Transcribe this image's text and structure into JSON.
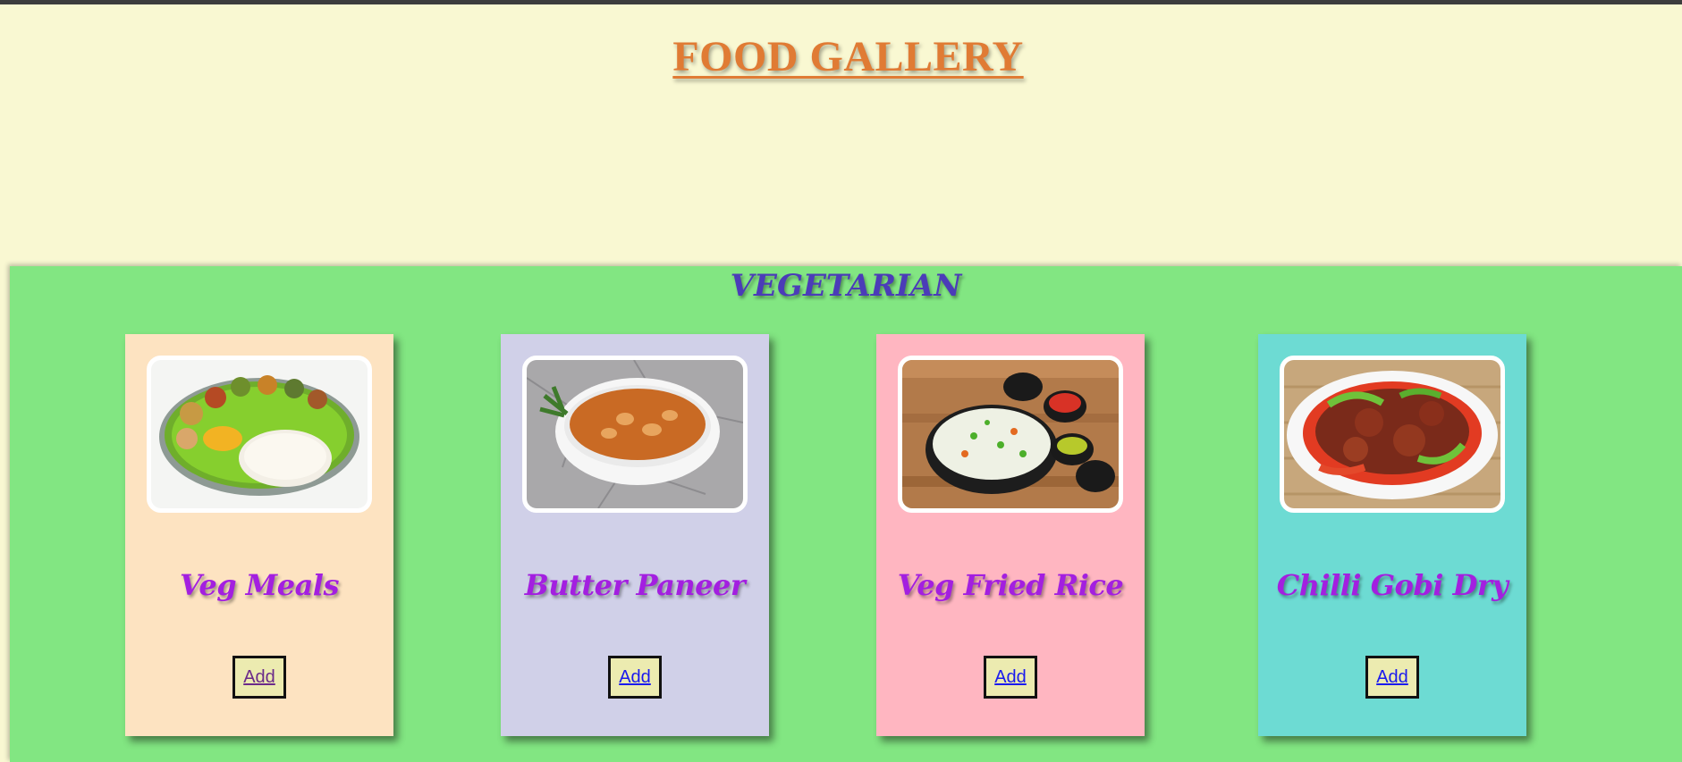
{
  "header": {
    "title": "FOOD GALLERY"
  },
  "section": {
    "title": "VEGETARIAN"
  },
  "cards": [
    {
      "name": "Veg Meals",
      "button_label": "Add",
      "bg_color": "#fde3c1",
      "image": "veg-meals-thali"
    },
    {
      "name": "Butter Paneer",
      "button_label": "Add",
      "bg_color": "#d0d0e8",
      "image": "butter-paneer-bowl"
    },
    {
      "name": "Veg Fried Rice",
      "button_label": "Add",
      "bg_color": "#ffb6c1",
      "image": "veg-fried-rice-bowl"
    },
    {
      "name": "Chilli Gobi Dry",
      "button_label": "Add",
      "bg_color": "#6ddbd3",
      "image": "chilli-gobi-plate"
    }
  ],
  "colors": {
    "page_bg": "#f9f8d2",
    "section_bg": "#82e682",
    "title_color": "#e07b34",
    "section_title_color": "#4b3cb8",
    "dish_name_color": "#a31fe0",
    "button_bg": "#ecebb0"
  }
}
